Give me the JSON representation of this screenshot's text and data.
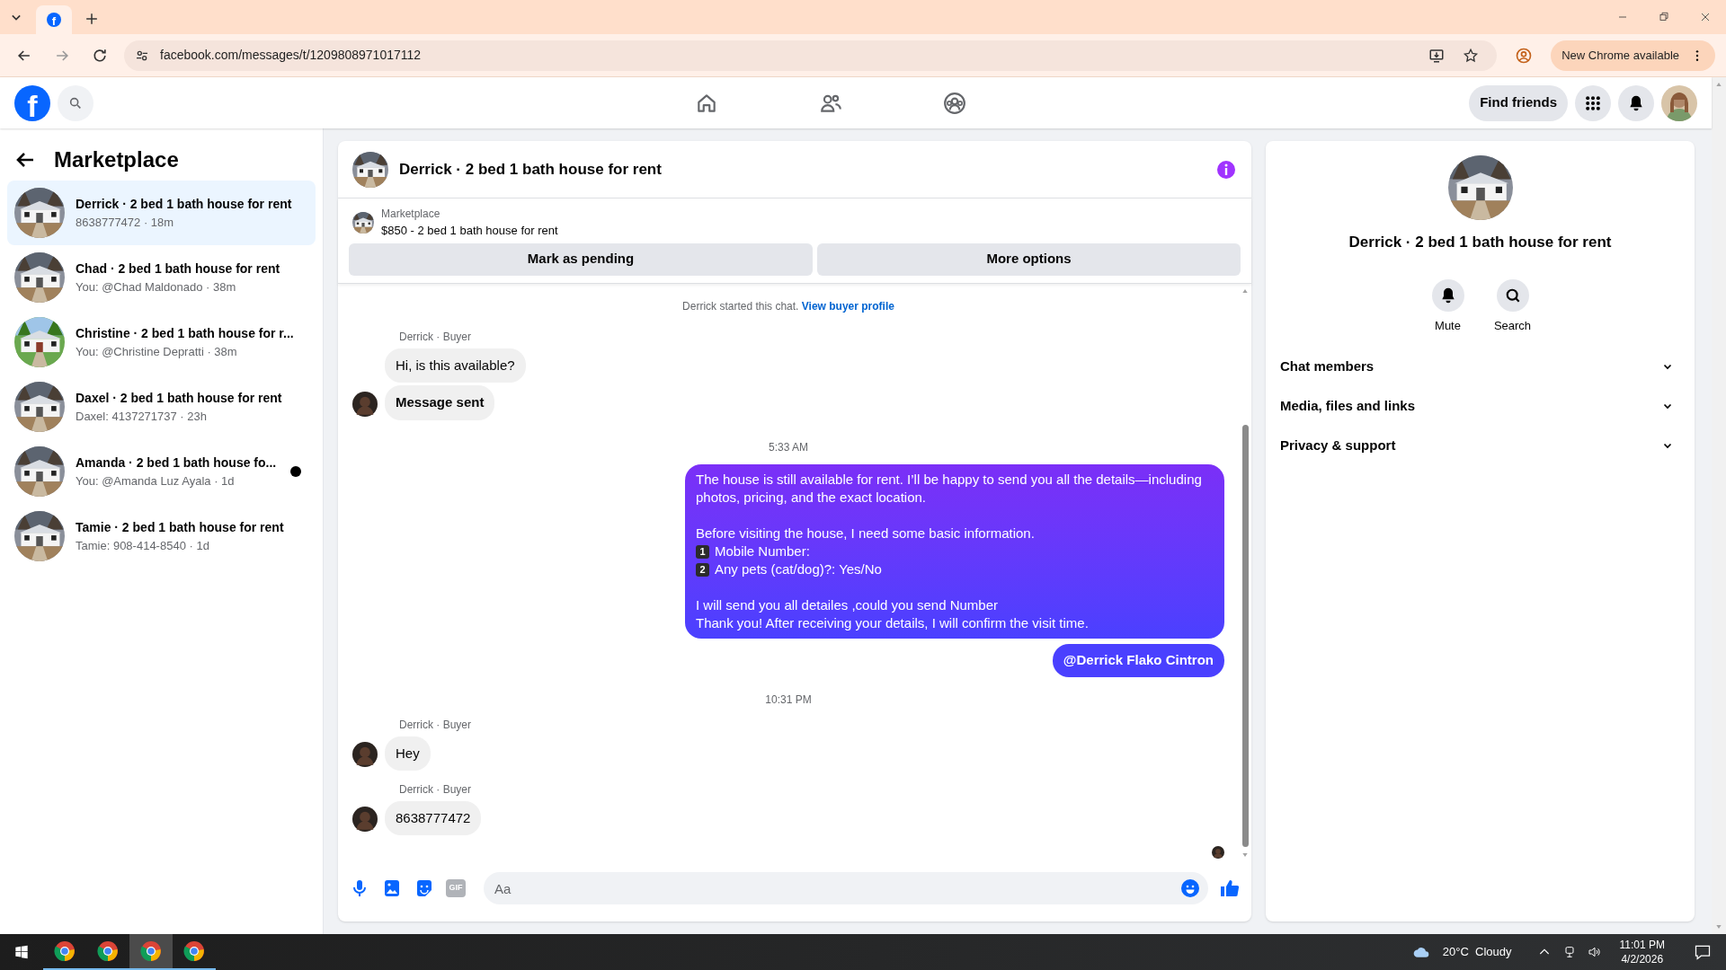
{
  "browser": {
    "tabs": [
      {
        "logo": "f",
        "selected": true
      }
    ],
    "url": "facebook.com/messages/t/1209808971017112",
    "update_button": "New Chrome available"
  },
  "header": {
    "logo": "f",
    "nav": [
      {
        "kind": "home"
      },
      {
        "kind": "friends"
      },
      {
        "kind": "groups"
      }
    ],
    "find_friends": "Find friends"
  },
  "sidebar": {
    "title": "Marketplace",
    "conversations": [
      {
        "title": "Derrick · 2 bed 1 bath house for rent",
        "preview": "8638777472 · 18m",
        "selected": true,
        "unread": false
      },
      {
        "title": "Chad · 2 bed 1 bath house for rent",
        "preview": "You: @Chad Maldonado · 38m",
        "selected": false,
        "unread": false
      },
      {
        "title": "Christine · 2 bed 1 bath house for r...",
        "preview": "You: @Christine Depratti · 38m",
        "selected": false,
        "unread": false
      },
      {
        "title": "Daxel · 2 bed 1 bath house for rent",
        "preview": "Daxel: 4137271737 · 23h",
        "selected": false,
        "unread": false
      },
      {
        "title": "Amanda · 2 bed 1 bath house fo...",
        "preview": "You: @Amanda Luz Ayala · 1d",
        "selected": false,
        "unread": true
      },
      {
        "title": "Tamie · 2 bed 1 bath house for rent",
        "preview": "Tamie: 908-414-8540 · 1d",
        "selected": false,
        "unread": false
      }
    ]
  },
  "chat": {
    "title": "Derrick · 2 bed 1 bath house for rent",
    "listing": {
      "label": "Marketplace",
      "name": "$850 - 2 bed 1 bath house for rent"
    },
    "buttons": [
      "Mark as pending",
      "More options"
    ],
    "thread": [
      {
        "kind": "system",
        "text": "Derrick started this chat.",
        "link": "View buyer profile"
      },
      {
        "kind": "incoming",
        "sender": "Derrick · Buyer",
        "messages": [
          {
            "text": "Hi, is this available?",
            "bold": false
          },
          {
            "text": "Message sent",
            "bold": true
          }
        ]
      },
      {
        "kind": "time",
        "text": "5:33 AM"
      },
      {
        "kind": "outgoing",
        "paragraphs": [
          [
            {
              "text": "The house is still available for rent. I’ll be happy to send you all the details—including photos, pricing, and the exact location."
            }
          ],
          [
            {
              "text": "Before visiting the house, I need some basic information."
            },
            {
              "badge": "1",
              "text": "Mobile Number:"
            },
            {
              "badge": "2",
              "text": "Any pets (cat/dog)?: Yes/No"
            }
          ],
          [
            {
              "text": "I will send you all detailes ,could you send Number"
            },
            {
              "text": "Thank you! After receiving your details, I will confirm the visit time."
            }
          ]
        ]
      },
      {
        "kind": "mention",
        "text": "@Derrick Flako Cintron"
      },
      {
        "kind": "time",
        "text": "10:31 PM"
      },
      {
        "kind": "incoming",
        "sender": "Derrick · Buyer",
        "messages": [
          {
            "text": "Hey",
            "bold": false
          }
        ]
      },
      {
        "kind": "incoming",
        "sender": "Derrick · Buyer",
        "messages": [
          {
            "text": "8638777472",
            "bold": false
          }
        ]
      },
      {
        "kind": "seen"
      }
    ],
    "composer": {
      "gif": "GIF",
      "placeholder": "Aa"
    }
  },
  "details": {
    "title": "Derrick · 2 bed 1 bath house for rent",
    "actions": [
      {
        "kind": "mute",
        "label": "Mute"
      },
      {
        "kind": "search",
        "label": "Search"
      }
    ],
    "sections": [
      {
        "label": "Chat members",
        "expanded": false
      },
      {
        "label": "Media, files and links",
        "expanded": false
      },
      {
        "label": "Privacy & support",
        "expanded": false
      }
    ]
  },
  "taskbar": {
    "apps": [
      {
        "selected": false
      },
      {
        "selected": false
      },
      {
        "selected": true
      },
      {
        "selected": false
      }
    ],
    "weather": "20°C  Cloudy",
    "time": "11:01 PM",
    "date": "4/2/2026"
  }
}
